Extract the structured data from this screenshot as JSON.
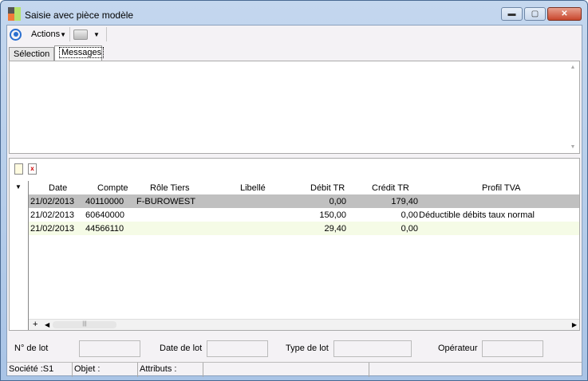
{
  "window": {
    "title": "Saisie avec pièce modèle",
    "minimize": "▬",
    "maximize": "▢",
    "close": "✕"
  },
  "toolbar": {
    "actions_label": "Actions"
  },
  "tabs": [
    {
      "label": "Sélection"
    },
    {
      "label": "Messages"
    }
  ],
  "grid": {
    "columns": [
      "Date",
      "Compte",
      "Rôle Tiers",
      "Libellé",
      "Débit TR",
      "Crédit TR",
      "Profil TVA"
    ],
    "rows": [
      {
        "date": "21/02/2013",
        "compte": "40110000",
        "role": "F-BUROWEST",
        "libelle": "",
        "debit": "0,00",
        "credit": "179,40",
        "profil": ""
      },
      {
        "date": "21/02/2013",
        "compte": "60640000",
        "role": "",
        "libelle": "",
        "debit": "150,00",
        "credit": "0,00",
        "profil": "Déductible débits taux normal"
      },
      {
        "date": "21/02/2013",
        "compte": "44566110",
        "role": "",
        "libelle": "",
        "debit": "29,40",
        "credit": "0,00",
        "profil": ""
      }
    ],
    "row_colors": [
      "#c0c0c0",
      "#ffffff",
      "#f5fbe6"
    ]
  },
  "fields": {
    "lot_no": "N° de lot",
    "lot_date": "Date de lot",
    "lot_type": "Type de lot",
    "operator": "Opérateur"
  },
  "status": {
    "societe": "Société :S1",
    "objet": "Objet :",
    "attributs": "Attributs :"
  }
}
